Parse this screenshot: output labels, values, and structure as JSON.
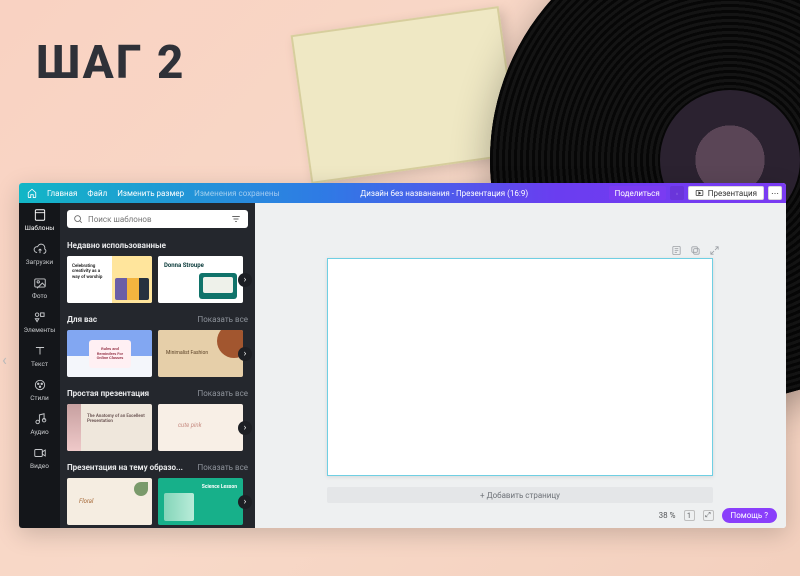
{
  "backdrop": {
    "step_title": "ШАГ 2"
  },
  "topbar": {
    "home": "Главная",
    "file": "Файл",
    "resize": "Изменить размер",
    "saved": "Изменения сохранены",
    "doc_title": "Дизайн без названания - Презентация (16:9)",
    "share": "Поделиться",
    "present": "Презентация"
  },
  "rail": {
    "templates": "Шаблоны",
    "uploads": "Загрузки",
    "photos": "Фото",
    "elements": "Элементы",
    "text": "Текст",
    "styles": "Стили",
    "audio": "Аудио",
    "video": "Видео"
  },
  "panel": {
    "search_placeholder": "Поиск шаблонов",
    "show_all": "Показать все",
    "sections": {
      "recent": "Недавно использованные",
      "for_you": "Для вас",
      "simple": "Простая презентация",
      "education": "Презентация на тему образо..."
    },
    "thumbs": {
      "t1": "Celebrating creativity as a way of worship",
      "t2": "Donna Stroupe",
      "t3": "Rules and Reminders For Online Classes",
      "t4": "Minimalist Fashion",
      "t5": "The Anatomy of an Excellent Presentation",
      "t6": "cute pink",
      "t7": "Floral",
      "t8": "Science Lesson"
    }
  },
  "canvas": {
    "add_page": "+ Добавить страницу",
    "zoom": "38 %",
    "grid_badge": "1",
    "help": "Помощь ?"
  }
}
